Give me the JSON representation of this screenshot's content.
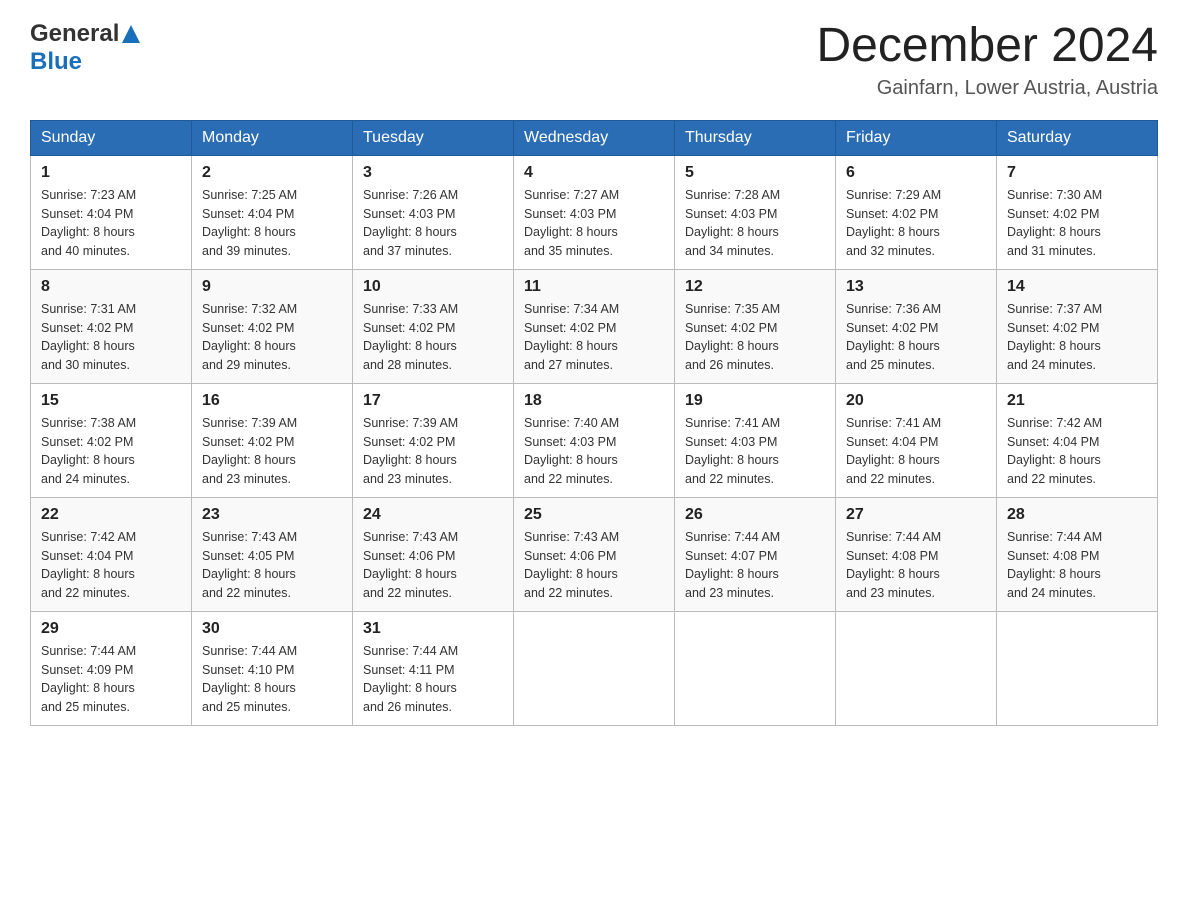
{
  "header": {
    "logo": {
      "general": "General",
      "blue": "Blue"
    },
    "title": "December 2024",
    "location": "Gainfarn, Lower Austria, Austria"
  },
  "days_of_week": [
    "Sunday",
    "Monday",
    "Tuesday",
    "Wednesday",
    "Thursday",
    "Friday",
    "Saturday"
  ],
  "weeks": [
    [
      {
        "day": "1",
        "sunrise": "7:23 AM",
        "sunset": "4:04 PM",
        "daylight": "8 hours and 40 minutes."
      },
      {
        "day": "2",
        "sunrise": "7:25 AM",
        "sunset": "4:04 PM",
        "daylight": "8 hours and 39 minutes."
      },
      {
        "day": "3",
        "sunrise": "7:26 AM",
        "sunset": "4:03 PM",
        "daylight": "8 hours and 37 minutes."
      },
      {
        "day": "4",
        "sunrise": "7:27 AM",
        "sunset": "4:03 PM",
        "daylight": "8 hours and 35 minutes."
      },
      {
        "day": "5",
        "sunrise": "7:28 AM",
        "sunset": "4:03 PM",
        "daylight": "8 hours and 34 minutes."
      },
      {
        "day": "6",
        "sunrise": "7:29 AM",
        "sunset": "4:02 PM",
        "daylight": "8 hours and 32 minutes."
      },
      {
        "day": "7",
        "sunrise": "7:30 AM",
        "sunset": "4:02 PM",
        "daylight": "8 hours and 31 minutes."
      }
    ],
    [
      {
        "day": "8",
        "sunrise": "7:31 AM",
        "sunset": "4:02 PM",
        "daylight": "8 hours and 30 minutes."
      },
      {
        "day": "9",
        "sunrise": "7:32 AM",
        "sunset": "4:02 PM",
        "daylight": "8 hours and 29 minutes."
      },
      {
        "day": "10",
        "sunrise": "7:33 AM",
        "sunset": "4:02 PM",
        "daylight": "8 hours and 28 minutes."
      },
      {
        "day": "11",
        "sunrise": "7:34 AM",
        "sunset": "4:02 PM",
        "daylight": "8 hours and 27 minutes."
      },
      {
        "day": "12",
        "sunrise": "7:35 AM",
        "sunset": "4:02 PM",
        "daylight": "8 hours and 26 minutes."
      },
      {
        "day": "13",
        "sunrise": "7:36 AM",
        "sunset": "4:02 PM",
        "daylight": "8 hours and 25 minutes."
      },
      {
        "day": "14",
        "sunrise": "7:37 AM",
        "sunset": "4:02 PM",
        "daylight": "8 hours and 24 minutes."
      }
    ],
    [
      {
        "day": "15",
        "sunrise": "7:38 AM",
        "sunset": "4:02 PM",
        "daylight": "8 hours and 24 minutes."
      },
      {
        "day": "16",
        "sunrise": "7:39 AM",
        "sunset": "4:02 PM",
        "daylight": "8 hours and 23 minutes."
      },
      {
        "day": "17",
        "sunrise": "7:39 AM",
        "sunset": "4:02 PM",
        "daylight": "8 hours and 23 minutes."
      },
      {
        "day": "18",
        "sunrise": "7:40 AM",
        "sunset": "4:03 PM",
        "daylight": "8 hours and 22 minutes."
      },
      {
        "day": "19",
        "sunrise": "7:41 AM",
        "sunset": "4:03 PM",
        "daylight": "8 hours and 22 minutes."
      },
      {
        "day": "20",
        "sunrise": "7:41 AM",
        "sunset": "4:04 PM",
        "daylight": "8 hours and 22 minutes."
      },
      {
        "day": "21",
        "sunrise": "7:42 AM",
        "sunset": "4:04 PM",
        "daylight": "8 hours and 22 minutes."
      }
    ],
    [
      {
        "day": "22",
        "sunrise": "7:42 AM",
        "sunset": "4:04 PM",
        "daylight": "8 hours and 22 minutes."
      },
      {
        "day": "23",
        "sunrise": "7:43 AM",
        "sunset": "4:05 PM",
        "daylight": "8 hours and 22 minutes."
      },
      {
        "day": "24",
        "sunrise": "7:43 AM",
        "sunset": "4:06 PM",
        "daylight": "8 hours and 22 minutes."
      },
      {
        "day": "25",
        "sunrise": "7:43 AM",
        "sunset": "4:06 PM",
        "daylight": "8 hours and 22 minutes."
      },
      {
        "day": "26",
        "sunrise": "7:44 AM",
        "sunset": "4:07 PM",
        "daylight": "8 hours and 23 minutes."
      },
      {
        "day": "27",
        "sunrise": "7:44 AM",
        "sunset": "4:08 PM",
        "daylight": "8 hours and 23 minutes."
      },
      {
        "day": "28",
        "sunrise": "7:44 AM",
        "sunset": "4:08 PM",
        "daylight": "8 hours and 24 minutes."
      }
    ],
    [
      {
        "day": "29",
        "sunrise": "7:44 AM",
        "sunset": "4:09 PM",
        "daylight": "8 hours and 25 minutes."
      },
      {
        "day": "30",
        "sunrise": "7:44 AM",
        "sunset": "4:10 PM",
        "daylight": "8 hours and 25 minutes."
      },
      {
        "day": "31",
        "sunrise": "7:44 AM",
        "sunset": "4:11 PM",
        "daylight": "8 hours and 26 minutes."
      },
      null,
      null,
      null,
      null
    ]
  ],
  "labels": {
    "sunrise": "Sunrise:",
    "sunset": "Sunset:",
    "daylight": "Daylight:"
  }
}
